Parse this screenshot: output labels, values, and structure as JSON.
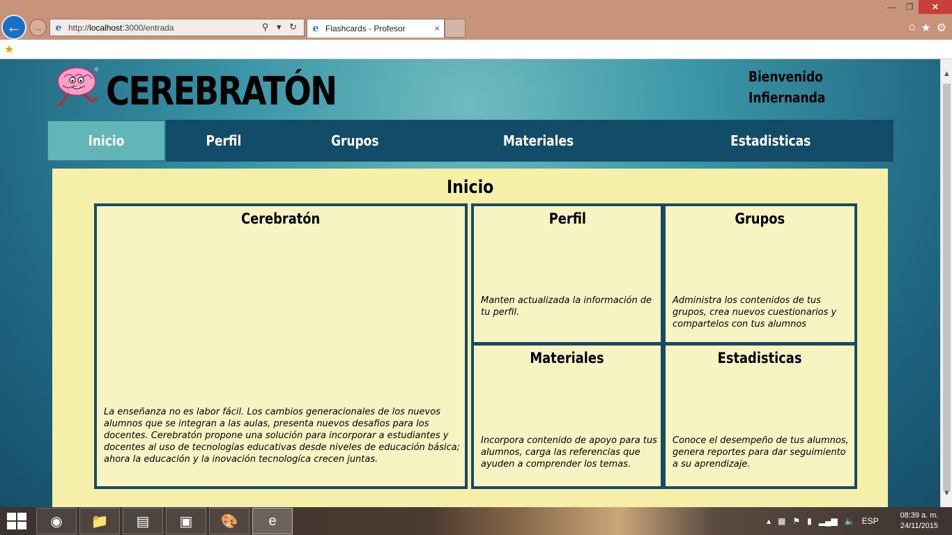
{
  "browser": {
    "url_prefix": "http://",
    "url_host": "localhost",
    "url_path": ":3000/entrada",
    "tab_title": "Flashcards - Profesor",
    "tab_close": "×",
    "address_tools": "⚲ ▾ ↻",
    "win_minimize": "—",
    "win_restore": "❐",
    "win_close": "✕"
  },
  "header": {
    "brand": "CEREBRATÓN",
    "welcome_line1": "Bienvenido",
    "welcome_line2": "Infiernanda"
  },
  "nav": {
    "items": [
      {
        "label": "Inicio"
      },
      {
        "label": "Perfil"
      },
      {
        "label": "Grupos"
      },
      {
        "label": "Materiales"
      },
      {
        "label": "Estadisticas"
      }
    ]
  },
  "main": {
    "title": "Inicio",
    "cards": {
      "cerebraton": {
        "title": "Cerebratón",
        "text": "La enseñanza no es labor fácil. Los cambios generacionales de los nuevos alumnos que se integran a las aulas, presenta nuevos desafios para los docentes. Cerebratón propone una solución para incorporar a estudiantes y docentes al uso de tecnologías educativas desde niveles de educación básica; ahora la educación y la inovación tecnologíca crecen juntas."
      },
      "perfil": {
        "title": "Perfil",
        "text": "Manten actualizada la información de tu perfil."
      },
      "grupos": {
        "title": "Grupos",
        "text": "Administra los contenidos de tus grupos, crea nuevos cuestionarios y compartelos con tus alumnos"
      },
      "materiales": {
        "title": "Materiales",
        "text": "Incorpora contenido de apoyo para tus alumnos, carga las referencias que ayuden a comprender los temas."
      },
      "estadisticas": {
        "title": "Estadisticas",
        "text": "Conoce el desempeño de tus alumnos, genera reportes para dar seguimiento a su aprendizaje."
      }
    }
  },
  "taskbar": {
    "language": "ESP",
    "time": "08:39 a. m.",
    "date": "24/11/2015"
  },
  "colors": {
    "nav_bg": "#134c68",
    "nav_active": "#62b6b7",
    "content_bg": "#f6efa9",
    "card_border": "#174b63"
  }
}
